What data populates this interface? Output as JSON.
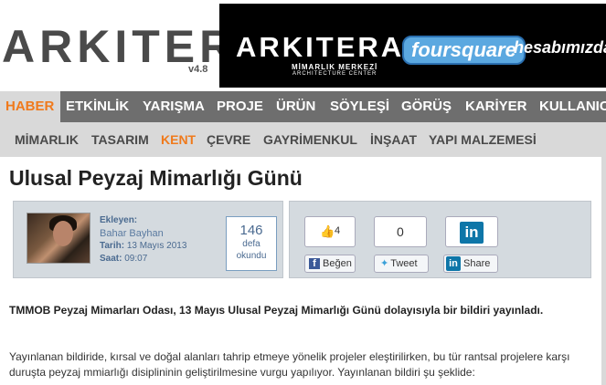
{
  "site": {
    "logo_text": "ARKITERA",
    "logo_version": "v4.8"
  },
  "banner": {
    "logo_text": "ARKITERA",
    "subtitle_line1": "MİMARLIK MERKEZİ",
    "subtitle_line2": "ARCHITECTURE CENTER",
    "foursquare_text": "foursquare",
    "right_text": "hesabımızda"
  },
  "main_nav": {
    "items": [
      {
        "label": "HABER",
        "active": true
      },
      {
        "label": "ETKİNLİK",
        "active": false
      },
      {
        "label": "YARIŞMA",
        "active": false
      },
      {
        "label": "PROJE",
        "active": false
      },
      {
        "label": "ÜRÜN",
        "active": false
      },
      {
        "label": "SÖYLEŞİ",
        "active": false
      },
      {
        "label": "GÖRÜŞ",
        "active": false
      },
      {
        "label": "KARİYER",
        "active": false
      },
      {
        "label": "KULLANICI",
        "active": false
      }
    ]
  },
  "sub_nav": {
    "items": [
      {
        "label": "MİMARLIK",
        "active": false
      },
      {
        "label": "TASARIM",
        "active": false
      },
      {
        "label": "KENT",
        "active": true
      },
      {
        "label": "ÇEVRE",
        "active": false
      },
      {
        "label": "GAYRİMENKUL",
        "active": false
      },
      {
        "label": "İNŞAAT",
        "active": false
      },
      {
        "label": "YAPI MALZEMESİ",
        "active": false
      }
    ]
  },
  "article": {
    "title": "Ulusal Peyzaj Mimarlığı Günü",
    "meta": {
      "added_by_label": "Ekleyen:",
      "author": "Bahar Bayhan",
      "date_label": "Tarih:",
      "date": "13 Mayıs 2013",
      "time_label": "Saat:",
      "time": "09:07"
    },
    "views": {
      "count": "146",
      "label_line1": "defa",
      "label_line2": "okundu"
    },
    "share": {
      "facebook_count": "4",
      "facebook_label": "Beğen",
      "twitter_count": "0",
      "twitter_label": "Tweet",
      "linkedin_logo": "in",
      "linkedin_label": "Share"
    },
    "lead": "TMMOB Peyzaj Mimarları Odası, 13 Mayıs Ulusal Peyzaj Mimarlığı Günü dolayısıyla bir bildiri yayınladı.",
    "body": "Yayınlanan bildiride, kırsal ve doğal alanları tahrip etmeye yönelik projeler eleştirilirken, bu tür rantsal projelere karşı duruşta peyzaj mmiarlığı disiplininin geliştirilmesine vurgu yapılıyor. Yayınlanan bildiri şu şeklide:"
  },
  "colors": {
    "accent": "#f07a1c",
    "nav_bg": "#6e6e6e",
    "subnav_bg": "#d9d9d9",
    "link": "#4a6a90",
    "facebook": "#3b5998",
    "linkedin": "#0e76a8"
  }
}
